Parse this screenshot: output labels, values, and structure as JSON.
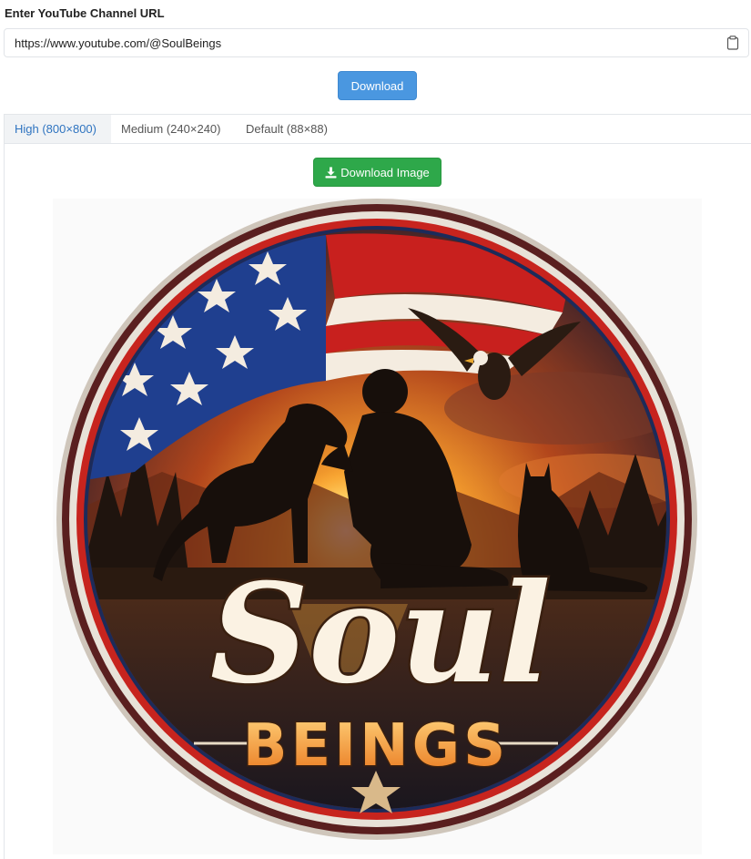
{
  "form": {
    "label": "Enter YouTube Channel URL",
    "url_value": "https://www.youtube.com/@SoulBeings",
    "clipboard_icon": "clipboard-icon",
    "download_label": "Download"
  },
  "tabs": [
    {
      "label": "High (800×800)",
      "active": true
    },
    {
      "label": "Medium (240×240)",
      "active": false
    },
    {
      "label": "Default (88×88)",
      "active": false
    }
  ],
  "panel": {
    "download_image_label": "Download Image",
    "download_icon": "download-icon"
  },
  "logo": {
    "script_text": "Soul",
    "block_text": "BEINGS"
  },
  "colors": {
    "primary": "#4a97e0",
    "success": "#2ea84a",
    "active_tab_text": "#2f74c0"
  }
}
